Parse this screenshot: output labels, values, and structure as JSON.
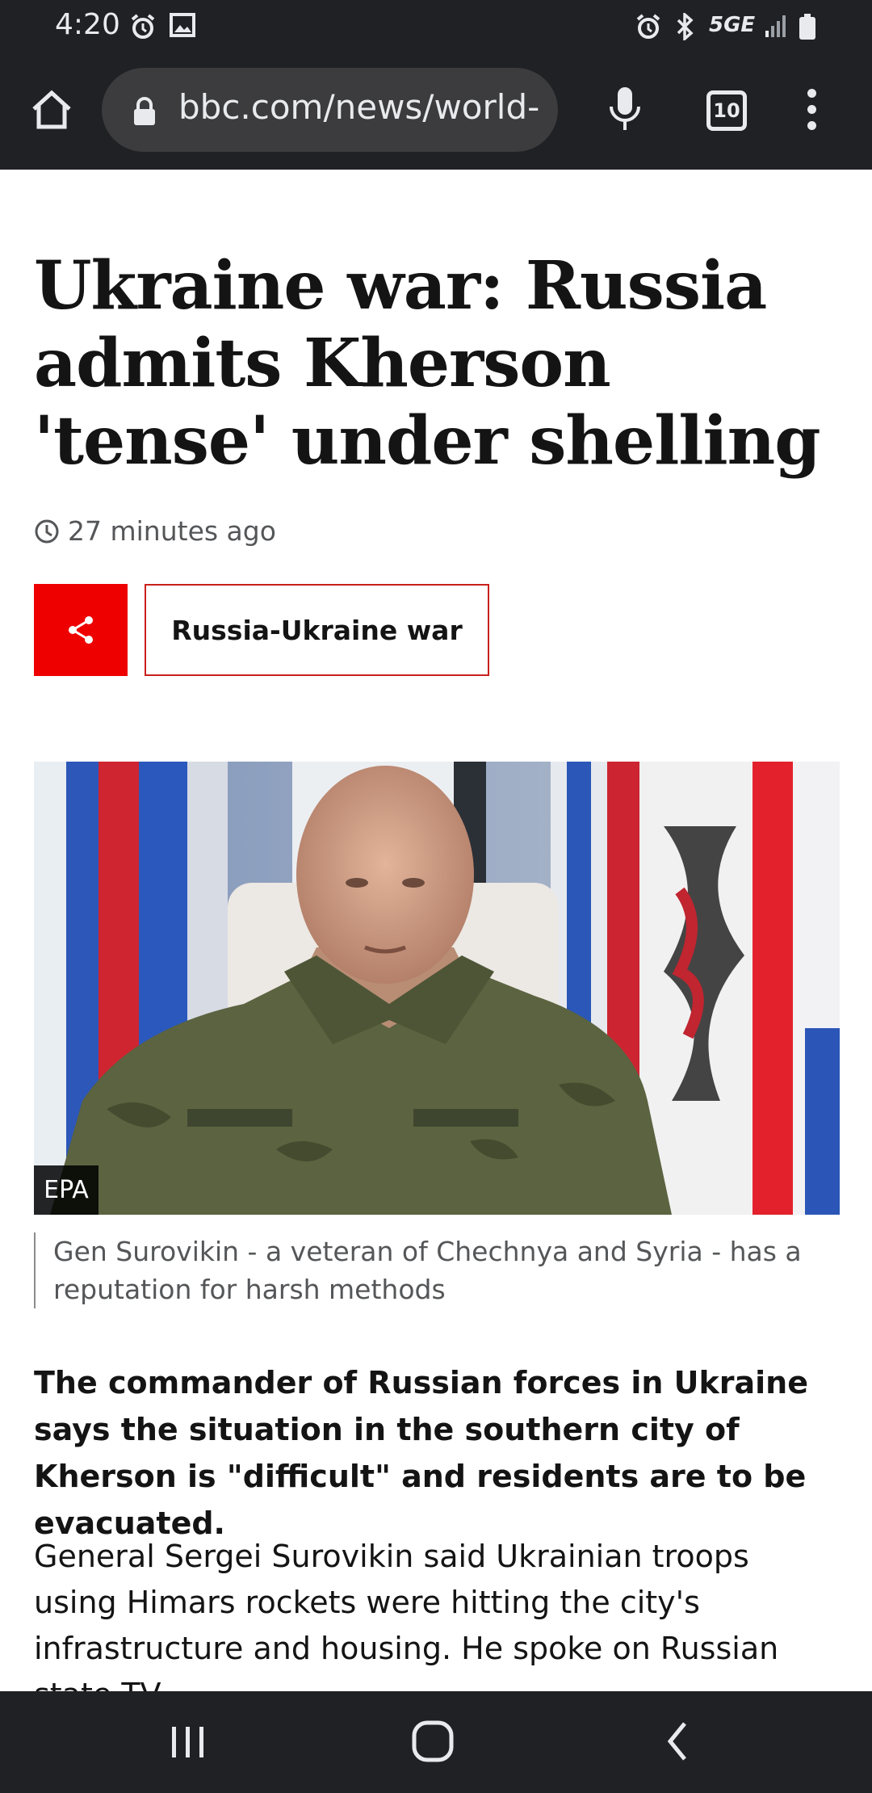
{
  "status_bar": {
    "time": "4:20",
    "network": "5GE",
    "icons": [
      "alarm-icon",
      "image-icon",
      "alarm-icon",
      "bluetooth-icon",
      "signal-icon",
      "battery-icon"
    ]
  },
  "browser": {
    "url": "bbc.com/news/world-",
    "tab_count": "10"
  },
  "article": {
    "headline": "Ukraine war: Russia admits Kherson 'tense' under shelling",
    "timestamp": "27 minutes ago",
    "topic_label": "Russia-Ukraine war",
    "image_credit": "EPA",
    "caption": "Gen Surovikin - a veteran of Chechnya and Syria - has a reputation for harsh methods",
    "lede": "The commander of Russian forces in Ukraine says the situation in the southern city of Kherson is \"difficult\" and residents are to be evacuated.",
    "paragraph": "General Sergei Surovikin said Ukrainian troops using Himars rockets were hitting the city's infrastructure and housing. He spoke on Russian state TV."
  },
  "colors": {
    "accent": "#ee0000",
    "chrome": "#202124"
  }
}
